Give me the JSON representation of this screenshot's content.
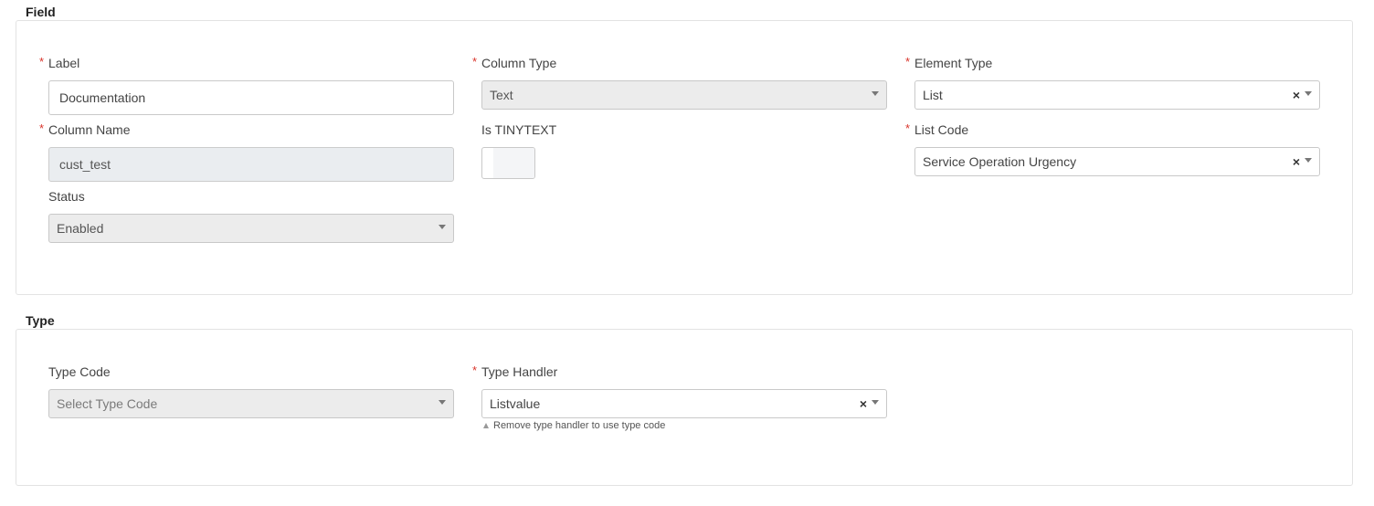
{
  "field_section": {
    "title": "Field",
    "label": {
      "label": "Label",
      "required": "*",
      "value": "Documentation"
    },
    "column_type": {
      "label": "Column Type",
      "required": "*",
      "value": "Text"
    },
    "element_type": {
      "label": "Element Type",
      "required": "*",
      "value": "List",
      "clear": "×"
    },
    "column_name": {
      "label": "Column Name",
      "required": "*",
      "value": "cust_test"
    },
    "is_tinytext": {
      "label": "Is TINYTEXT"
    },
    "list_code": {
      "label": "List Code",
      "required": "*",
      "value": "Service Operation Urgency",
      "clear": "×"
    },
    "status": {
      "label": "Status",
      "value": "Enabled"
    }
  },
  "type_section": {
    "title": "Type",
    "type_code": {
      "label": "Type Code",
      "placeholder": "Select Type Code"
    },
    "type_handler": {
      "label": "Type Handler",
      "required": "*",
      "value": "Listvalue",
      "clear": "×",
      "hint": "Remove type handler to use type code"
    }
  },
  "colors": {
    "required": "#d9342b",
    "border": "#c9c9c9",
    "disabled_bg": "#ececec"
  },
  "icons": [
    "chevron-down-icon",
    "clear-icon",
    "warning-triangle-icon"
  ]
}
